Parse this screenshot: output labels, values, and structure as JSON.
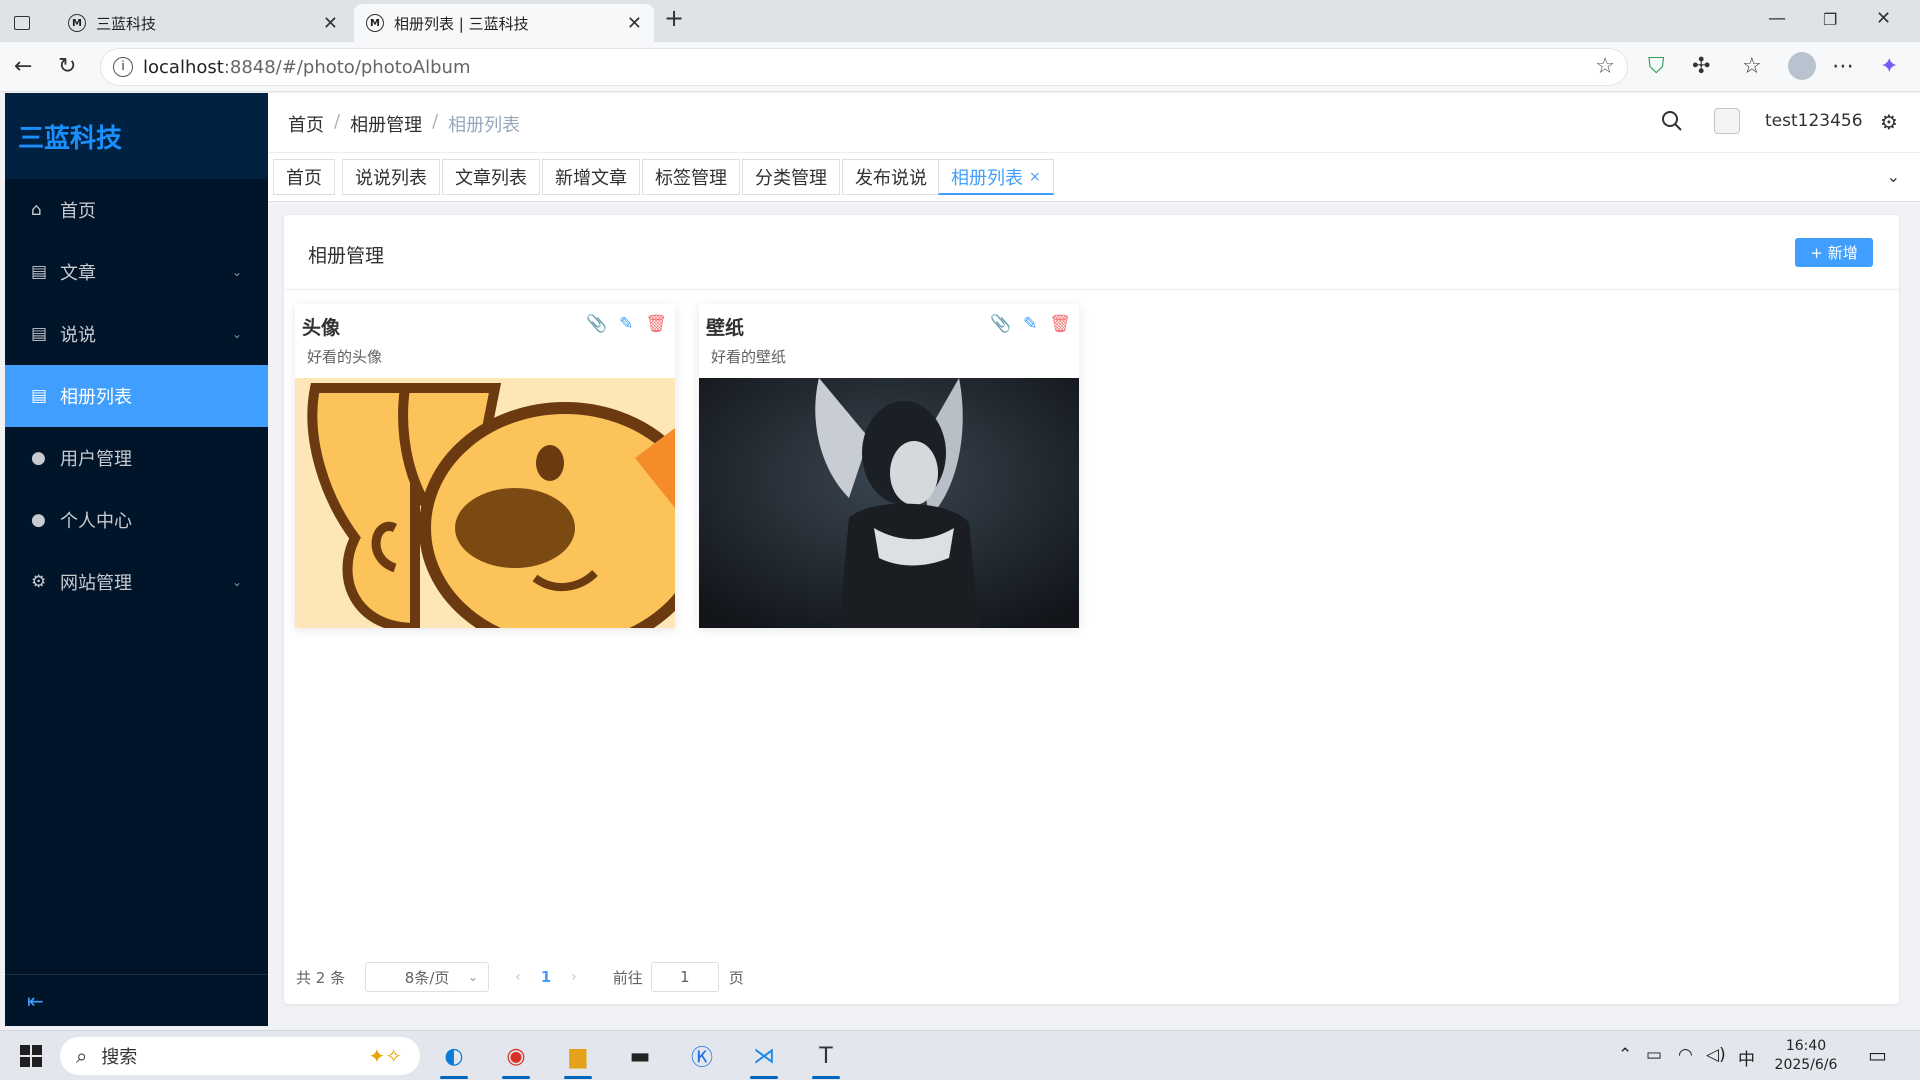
{
  "browser": {
    "tabs": [
      {
        "title": "三蓝科技",
        "favicon": "M"
      },
      {
        "title": "相册列表 | 三蓝科技",
        "favicon": "M"
      }
    ],
    "url_host": "localhost",
    "url_path": ":8848/#/photo/photoAlbum"
  },
  "sidebar": {
    "logo": "三蓝科技",
    "items": [
      {
        "label": "首页",
        "icon": "home-icon",
        "expandable": false
      },
      {
        "label": "文章",
        "icon": "document-icon",
        "expandable": true
      },
      {
        "label": "说说",
        "icon": "document-icon",
        "expandable": true
      },
      {
        "label": "相册列表",
        "icon": "document-icon",
        "expandable": false,
        "active": true
      },
      {
        "label": "用户管理",
        "icon": "user-icon",
        "expandable": false
      },
      {
        "label": "个人中心",
        "icon": "user-icon",
        "expandable": false
      },
      {
        "label": "网站管理",
        "icon": "gear-icon",
        "expandable": true
      }
    ]
  },
  "header": {
    "breadcrumb": [
      "首页",
      "相册管理",
      "相册列表"
    ],
    "username": "test123456"
  },
  "tags": {
    "items": [
      "首页",
      "说说列表",
      "文章列表",
      "新增文章",
      "标签管理",
      "分类管理",
      "发布说说",
      "相册列表"
    ],
    "active": "相册列表",
    "close_glyph": "×"
  },
  "main": {
    "title": "相册管理",
    "add_button": "新增",
    "add_icon": "+",
    "albums": [
      {
        "name": "头像",
        "description": "好看的头像"
      },
      {
        "name": "壁纸",
        "description": "好看的壁纸"
      }
    ],
    "colors": {
      "primary": "#409eff",
      "upload": "#67c23a",
      "danger": "#f56c6c"
    }
  },
  "pagination": {
    "total_text": "共 2 条",
    "page_size": "8条/页",
    "current_page": "1",
    "goto_label": "前往",
    "goto_value": "1",
    "page_unit": "页"
  },
  "taskbar": {
    "search_placeholder": "搜索",
    "ime": "中",
    "time": "16:40",
    "date": "2025/6/6"
  }
}
